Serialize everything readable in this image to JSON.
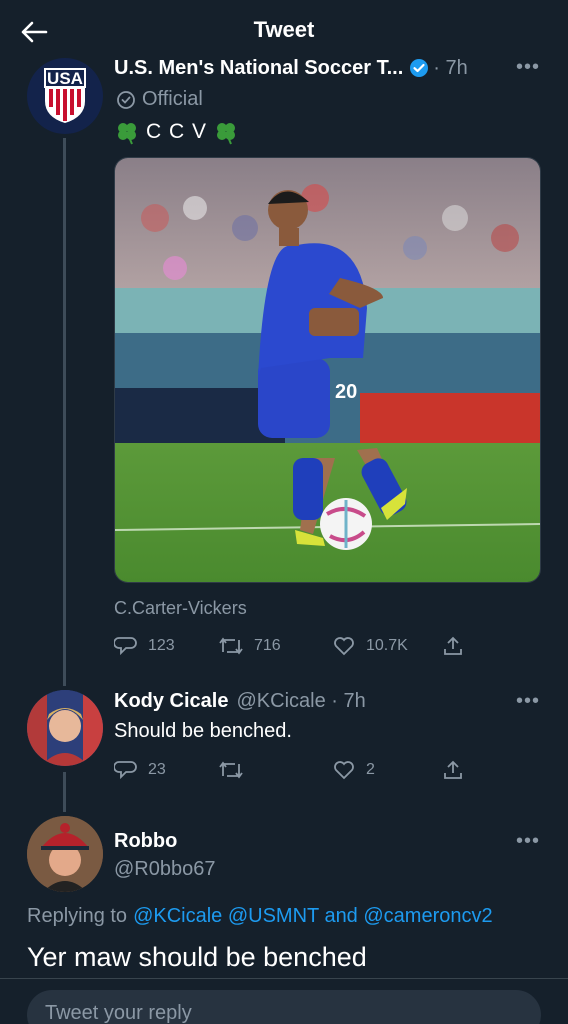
{
  "header": {
    "title": "Tweet"
  },
  "main_tweet": {
    "author_name": "U.S. Men's National Soccer T...",
    "dot_time": "· 7h",
    "official_label": "Official",
    "text": "C C V",
    "photo_caption": "C.Carter-Vickers",
    "replies": "123",
    "retweets": "716",
    "likes": "10.7K",
    "jersey_number": "20"
  },
  "reply1": {
    "author_name": "Kody Cicale",
    "handle_time": "@KCicale · 7h",
    "text": "Should be benched.",
    "replies": "23",
    "likes": "2"
  },
  "reply2": {
    "author_name": "Robbo",
    "handle": "@R0bbo67",
    "replying_prefix": "Replying to",
    "replying_to": "@KCicale @USMNT and @cameroncv2",
    "text": "Yer maw should be benched"
  },
  "composer": {
    "placeholder": "Tweet your reply"
  },
  "colors": {
    "background": "#15202b",
    "accent": "#1d9bf0",
    "muted": "#8b98a5"
  },
  "icons": [
    "back-arrow-icon",
    "verified-badge-icon",
    "official-badge-icon",
    "clover-icon",
    "reply-icon",
    "retweet-icon",
    "like-icon",
    "share-icon",
    "more-icon"
  ]
}
